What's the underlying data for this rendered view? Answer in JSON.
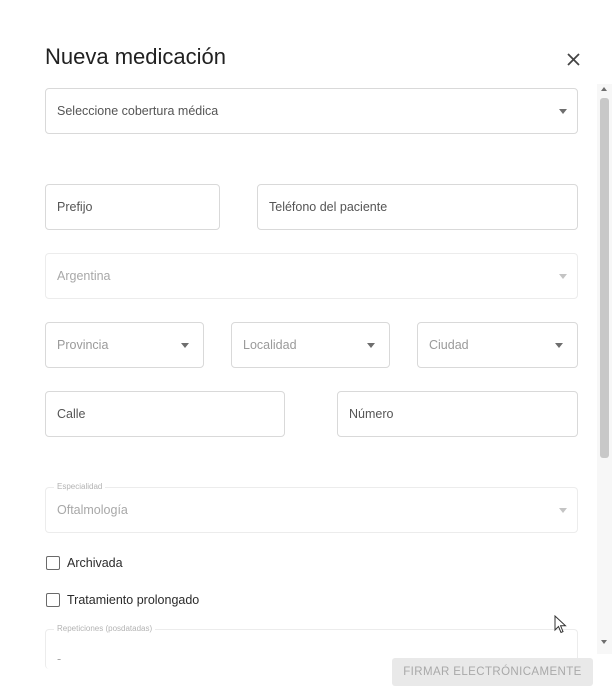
{
  "dialog": {
    "title": "Nueva medicación",
    "close_icon": "close-icon"
  },
  "form": {
    "coverage": {
      "placeholder": "Seleccione cobertura médica"
    },
    "prefix": {
      "placeholder": "Prefijo"
    },
    "phone": {
      "placeholder": "Teléfono del paciente"
    },
    "country": {
      "value": "Argentina"
    },
    "province": {
      "placeholder": "Provincia"
    },
    "locality": {
      "placeholder": "Localidad"
    },
    "city": {
      "placeholder": "Ciudad"
    },
    "street": {
      "placeholder": "Calle"
    },
    "number": {
      "placeholder": "Número"
    },
    "specialty": {
      "label": "Especialidad",
      "value": "Oftalmología"
    },
    "archived": {
      "label": "Archivada",
      "checked": false
    },
    "prolonged": {
      "label": "Tratamiento prolongado",
      "checked": false
    },
    "repetitions": {
      "label": "Repeticiones (posdatadas)",
      "value": "-"
    }
  },
  "actions": {
    "sign_label": "FIRMAR ELECTRÓNICAMENTE"
  },
  "colors": {
    "border": "#d9d9d9",
    "disabled_text": "#a8a8a8",
    "button_bg": "#e9e9e9"
  }
}
